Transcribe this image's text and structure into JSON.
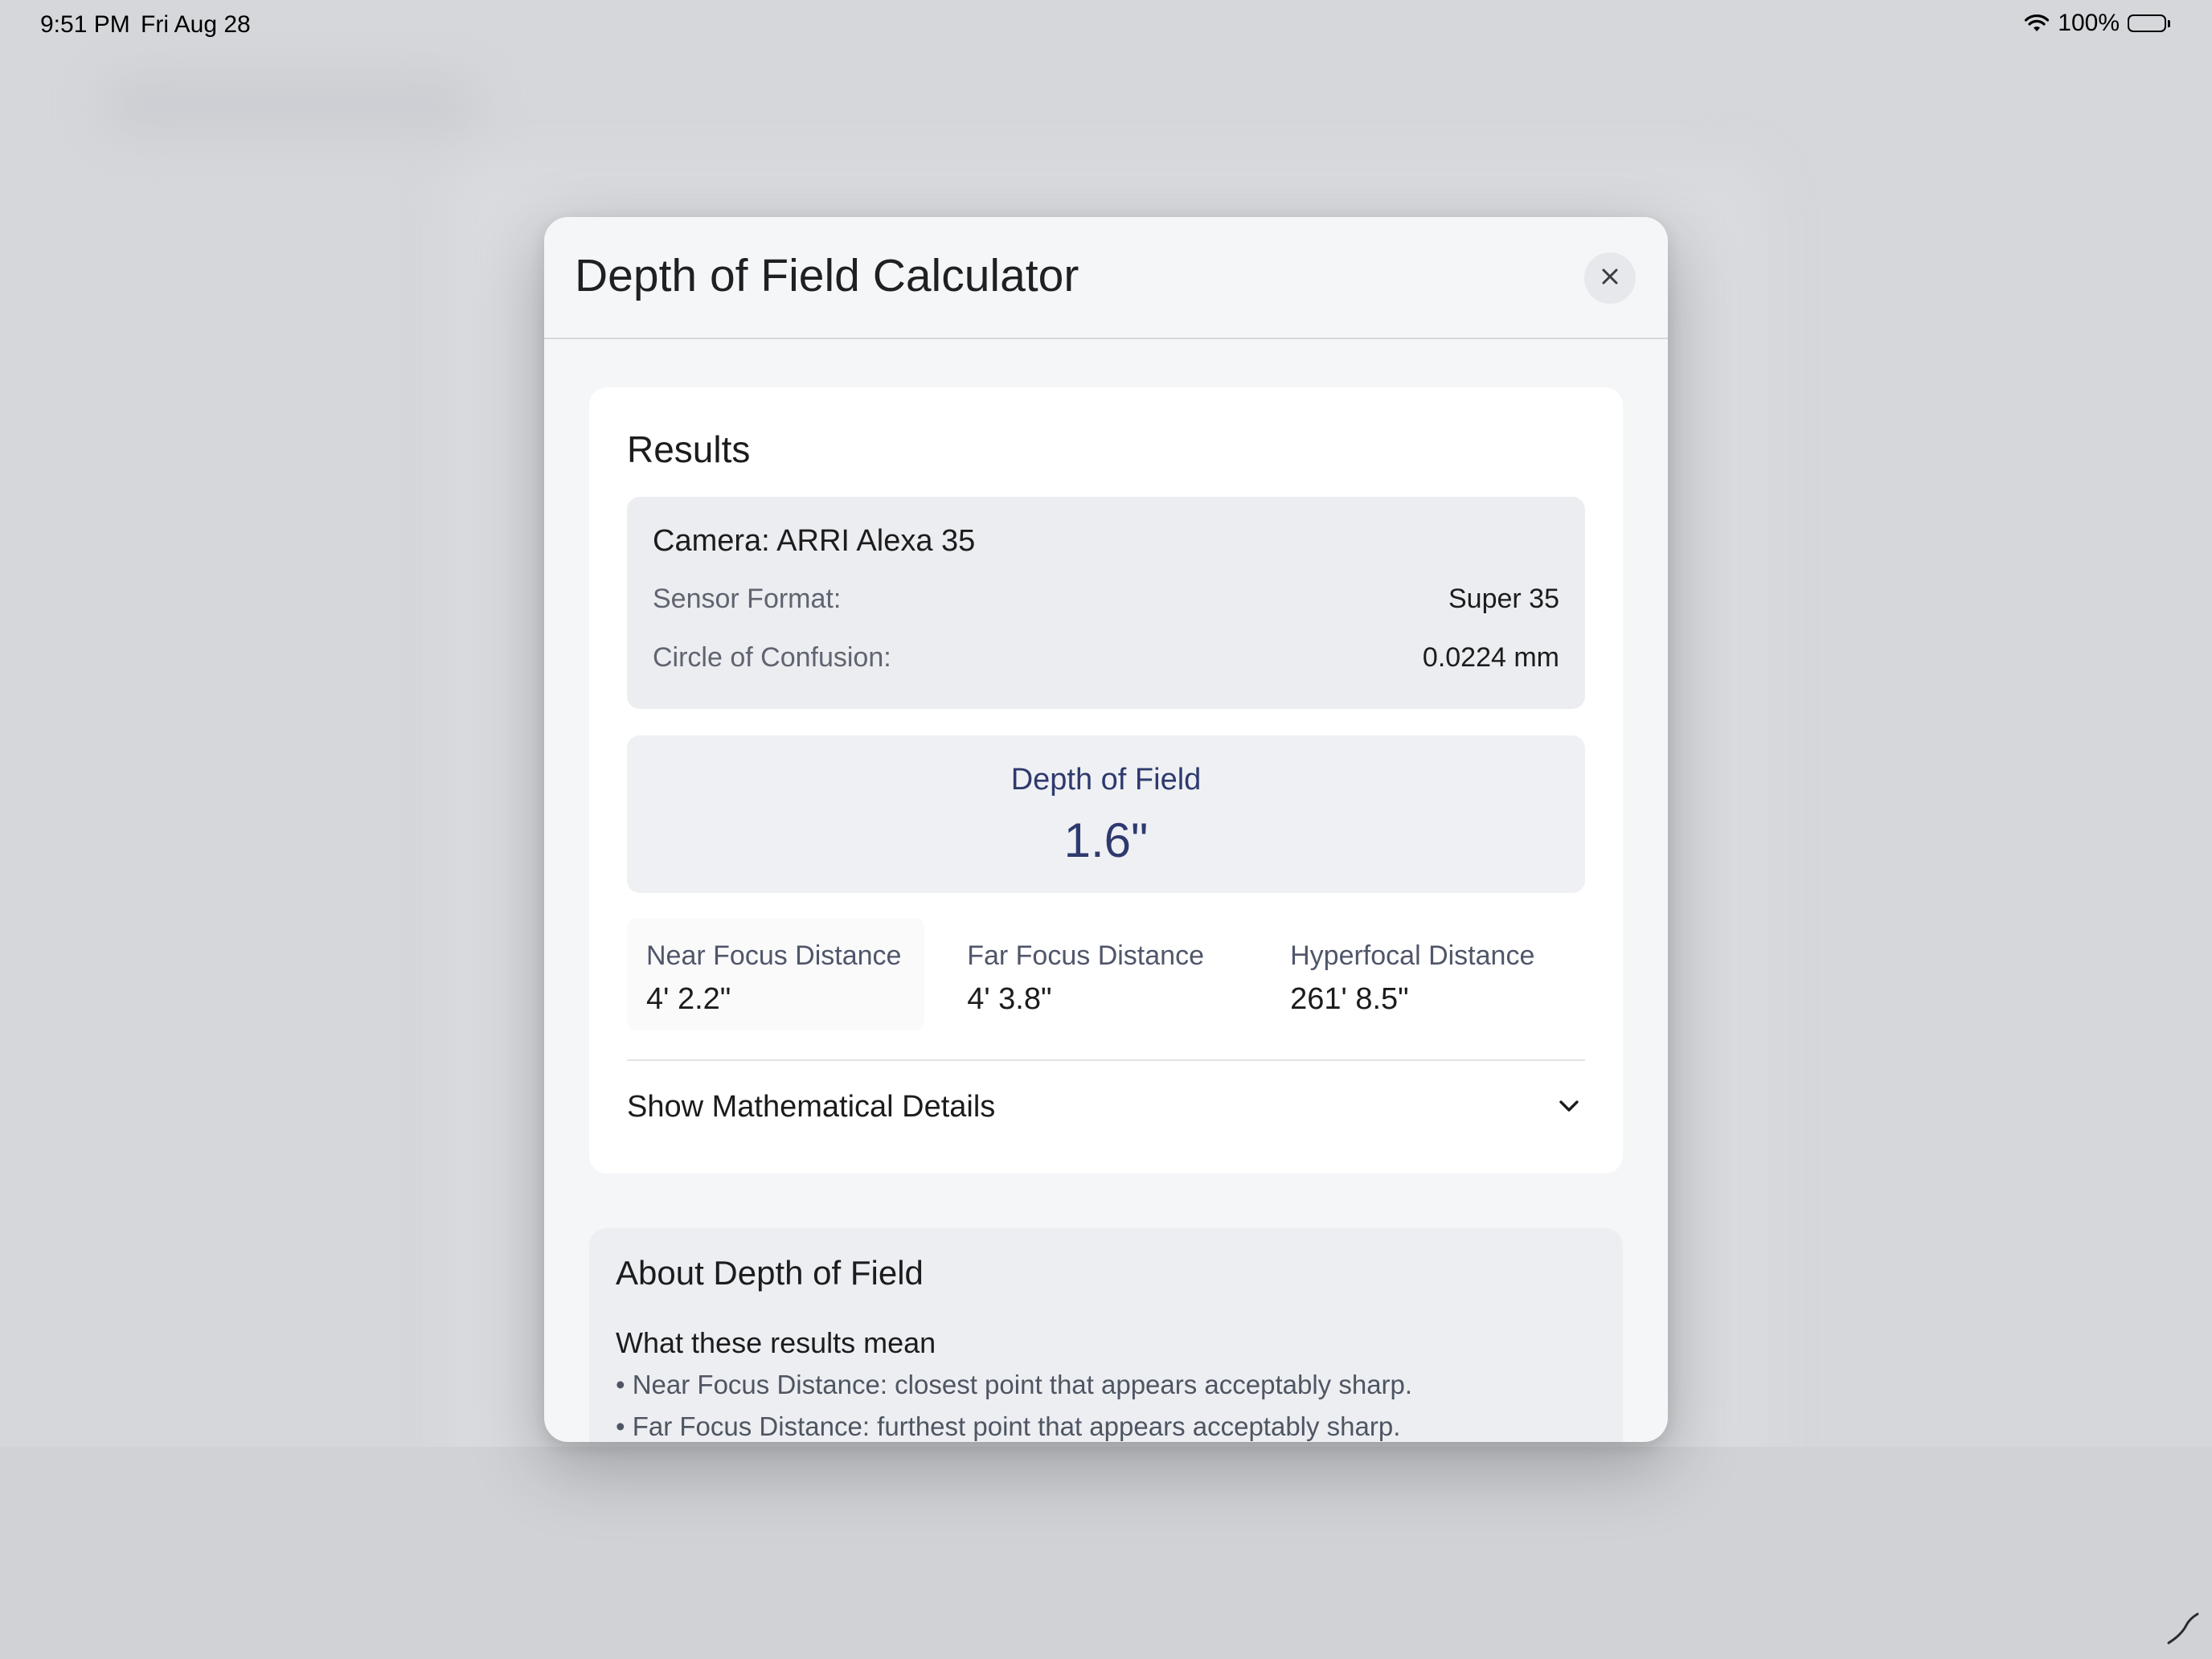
{
  "status_bar": {
    "time": "9:51 PM",
    "date": "Fri Aug 28",
    "battery_percent": "100%",
    "battery_level": 1.0,
    "icons": [
      "wifi-icon",
      "battery-icon"
    ]
  },
  "modal": {
    "title": "Depth of Field Calculator",
    "close_icon": "close-icon"
  },
  "results": {
    "title": "Results",
    "camera": {
      "name": "Camera: ARRI Alexa 35",
      "sensor_format_label": "Sensor Format:",
      "sensor_format_value": "Super 35",
      "coc_label": "Circle of Confusion:",
      "coc_value": "0.0224 mm"
    },
    "dof": {
      "label": "Depth of Field",
      "value": "1.6\""
    },
    "metrics": [
      {
        "label": "Near Focus Distance",
        "value": "4' 2.2\""
      },
      {
        "label": "Far Focus Distance",
        "value": "4' 3.8\""
      },
      {
        "label": "Hyperfocal Distance",
        "value": "261' 8.5\""
      }
    ],
    "details_toggle": {
      "label": "Show Mathematical Details",
      "icon": "chevron-down-icon"
    }
  },
  "about": {
    "title": "About Depth of Field",
    "subtitle": "What these results mean",
    "items": [
      "• Near Focus Distance: closest point that appears acceptably sharp.",
      "• Far Focus Distance: furthest point that appears acceptably sharp."
    ]
  },
  "colors": {
    "accent_navy": "#2e3a6e",
    "backdrop": "#d5d7db",
    "modal_bg": "#f5f6f8"
  }
}
